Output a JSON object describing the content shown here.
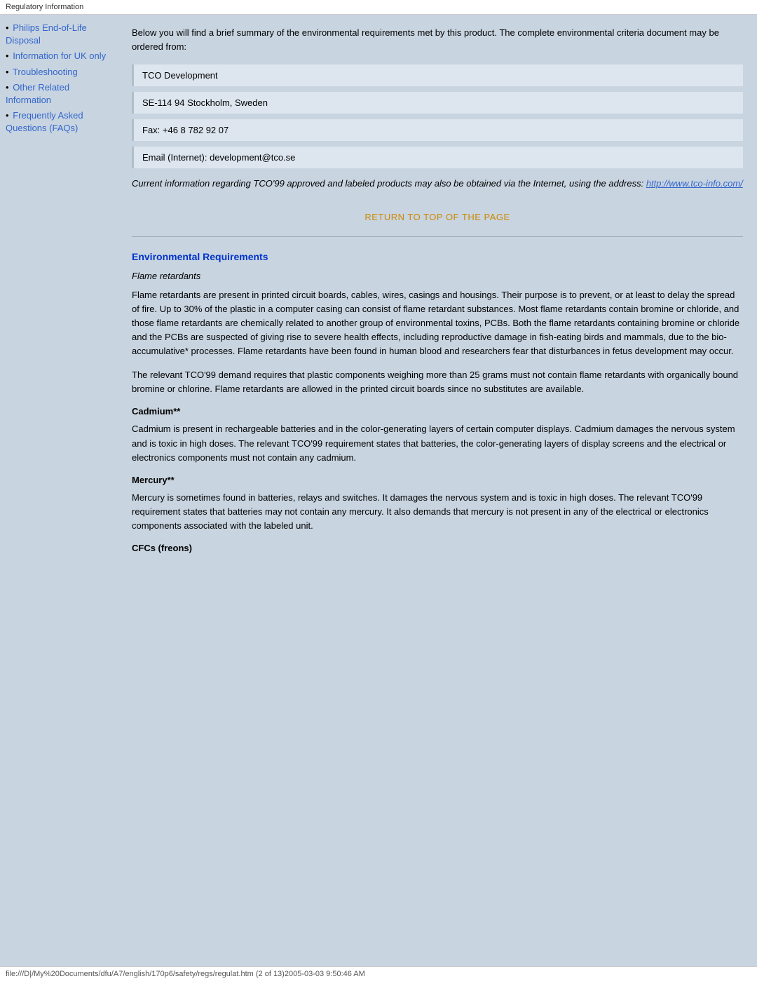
{
  "topbar": {
    "label": "Regulatory Information"
  },
  "sidebar": {
    "items": [
      {
        "label": "Philips End-of-Life Disposal",
        "href": "#",
        "bullet": "•"
      },
      {
        "label": "Information for UK only",
        "href": "#",
        "bullet": "•"
      },
      {
        "label": "Troubleshooting",
        "href": "#",
        "bullet": "•"
      },
      {
        "label": "Other Related Information",
        "href": "#",
        "bullet": "•"
      },
      {
        "label": "Frequently Asked Questions (FAQs)",
        "href": "#",
        "bullet": "•"
      }
    ]
  },
  "content": {
    "intro": "Below you will find a brief summary of the environmental requirements met by this product. The complete environmental criteria document may be ordered from:",
    "tco_lines": [
      "TCO Development",
      "SE-114 94 Stockholm, Sweden",
      "Fax: +46 8 782 92 07",
      "Email (Internet): development@tco.se"
    ],
    "italic_note": "Current information regarding TCO'99 approved and labeled products may also be obtained via the Internet, using the address: ",
    "italic_link_text": "http://www.tco-info.com/",
    "italic_link_href": "http://www.tco-info.com/",
    "return_link": "RETURN TO TOP OF THE PAGE",
    "section_title": "Environmental Requirements",
    "sub_title": "Flame retardants",
    "paragraphs": [
      "Flame retardants are present in printed circuit boards, cables, wires, casings and housings. Their purpose is to prevent, or at least to delay the spread of fire. Up to 30% of the plastic in a computer casing can consist of flame retardant substances. Most flame retardants contain bromine or chloride, and those flame retardants are chemically related to another group of environmental toxins, PCBs. Both the flame retardants containing bromine or chloride and the PCBs are suspected of giving rise to severe health effects, including reproductive damage in fish-eating birds and mammals, due to the bio-accumulative* processes. Flame retardants have been found in human blood and researchers fear that disturbances in fetus development may occur.",
      "The relevant TCO'99 demand requires that plastic components weighing more than 25 grams must not contain flame retardants with organically bound bromine or chlorine. Flame retardants are allowed in the printed circuit boards since no substitutes are available."
    ],
    "cadmium_heading": "Cadmium**",
    "cadmium_text": "Cadmium is present in rechargeable batteries and in the color-generating layers of certain computer displays. Cadmium damages the nervous system and is toxic in high doses. The relevant TCO'99 requirement states that batteries, the color-generating layers of display screens and the electrical or electronics components must not contain any cadmium.",
    "mercury_heading": "Mercury**",
    "mercury_text": "Mercury is sometimes found in batteries, relays and switches. It damages the nervous system and is toxic in high doses. The relevant TCO'99 requirement states that batteries may not contain any mercury. It also demands that mercury is not present in any of the electrical or electronics components associated with the labeled unit.",
    "cfcs_heading": "CFCs (freons)"
  },
  "bottombar": {
    "label": "file:///D|/My%20Documents/dfu/A7/english/170p6/safety/regs/regulat.htm (2 of 13)2005-03-03 9:50:46 AM"
  }
}
